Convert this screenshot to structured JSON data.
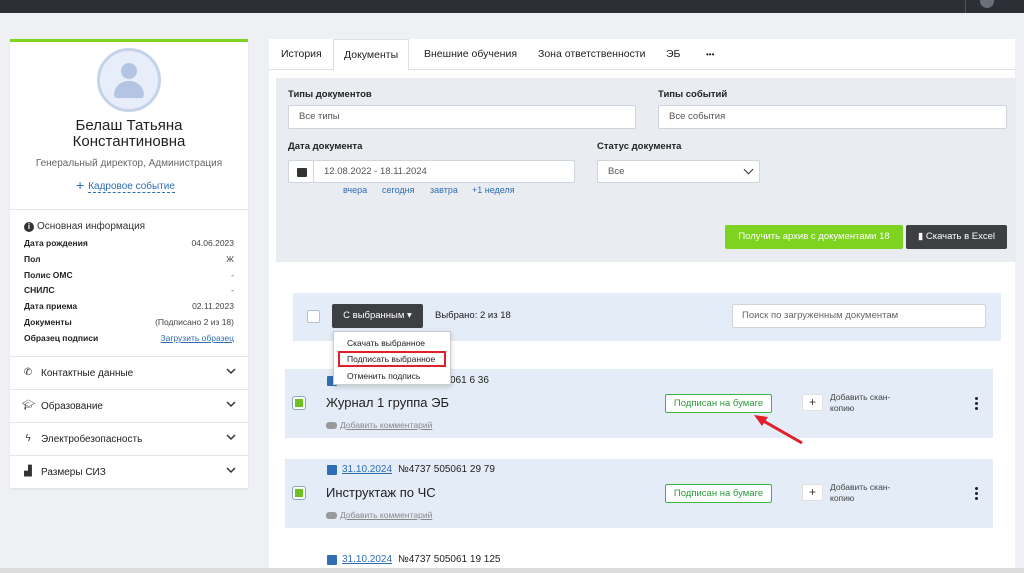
{
  "profile": {
    "name_line1": "Белаш Татьяна",
    "name_line2": "Константиновна",
    "position": "Генеральный директор, Администрация",
    "hr_event": "Кадровое событие",
    "info_title": "Основная информация",
    "info": [
      {
        "k": "Дата рождения",
        "v": "04.06.2023"
      },
      {
        "k": "Пол",
        "v": "Ж"
      },
      {
        "k": "Полис ОМС",
        "v": "-"
      },
      {
        "k": "СНИЛС",
        "v": "-"
      },
      {
        "k": "Дата приема",
        "v": "02.11.2023"
      },
      {
        "k": "Документы",
        "v": "(Подписано 2 из 18)"
      },
      {
        "k": "Образец подписи",
        "v": "Загрузить образец"
      }
    ],
    "sections": [
      "Контактные данные",
      "Образование",
      "Электробезопасность",
      "Размеры СИЗ"
    ]
  },
  "tabs": [
    "История",
    "Документы",
    "Внешние обучения",
    "Зона ответственности",
    "ЭБ",
    "•••"
  ],
  "filters": {
    "doc_types_label": "Типы документов",
    "doc_types_value": "Все типы",
    "event_types_label": "Типы событий",
    "event_types_value": "Все события",
    "doc_date_label": "Дата документа",
    "doc_date_value": "12.08.2022 - 18.11.2024",
    "quick": [
      "вчера",
      "сегодня",
      "завтра",
      "+1 неделя"
    ],
    "doc_status_label": "Статус документа",
    "doc_status_value": "Все",
    "archive_button": "Получить архив с документами 18",
    "excel_button": "Скачать в Excel"
  },
  "toolbar": {
    "with_selected": "С выбранным ▾",
    "selected_count": "Выбрано: 2 из 18",
    "search_placeholder": "Поиск по загруженным документам"
  },
  "dropdown": [
    "Скачать выбранное",
    "Подписать выбранное",
    "Отменить подпись"
  ],
  "documents": [
    {
      "date": "",
      "number": "061 6 36",
      "title": "Журнал 1 группа ЭБ",
      "status": "Подписан на бумаге",
      "comment": "Добавить комментарий",
      "scan": "Добавить скан-копию"
    },
    {
      "date": "31.10.2024",
      "number": "№4737 505061 29 79",
      "title": "Инструктаж по ЧС",
      "status": "Подписан на бумаге",
      "comment": "Добавить комментарий",
      "scan": "Добавить скан-копию"
    },
    {
      "date": "31.10.2024",
      "number": "№4737 505061 19 125"
    }
  ],
  "colors": {
    "accent_green": "#7ed321",
    "link_blue": "#2f6db5",
    "highlight_red": "#e0202a",
    "dark_button": "#3d3f43"
  }
}
